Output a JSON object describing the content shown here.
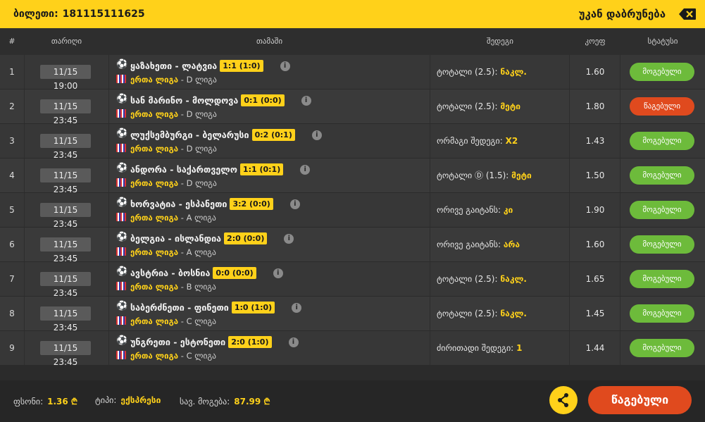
{
  "header": {
    "ticket_label": "ბილეთი:",
    "ticket_number": "181115111625",
    "back_label": "უკან დაბრუნება"
  },
  "columns": [
    "#",
    "თარიღი",
    "თამაში",
    "შედეგი",
    "კოეფ",
    "სტატუსი"
  ],
  "rows": [
    {
      "num": "1",
      "date": "11/15 19:00",
      "match": "ყაზახეთი - ლატვია",
      "score": "1:1 (1:0)",
      "league": "ერთა ლიგა",
      "league_suffix": "- D ლიგა",
      "event": "ტოტალი (2.5):",
      "pick": "ნაკლ.",
      "odds": "1.60",
      "status": "მოგებული",
      "status_type": "won"
    },
    {
      "num": "2",
      "date": "11/15 23:45",
      "match": "სან მარინო - მოლდოვა",
      "score": "0:1 (0:0)",
      "league": "ერთა ლიგა",
      "league_suffix": "- D ლიგა",
      "event": "ტოტალი (2.5):",
      "pick": "მეტი",
      "odds": "1.80",
      "status": "წაგებული",
      "status_type": "lost"
    },
    {
      "num": "3",
      "date": "11/15 23:45",
      "match": "ლუქსემბურგი - ბელარუსი",
      "score": "0:2 (0:1)",
      "league": "ერთა ლიგა",
      "league_suffix": "- D ლიგა",
      "event": "ორმაგი შედეგი:",
      "pick": "X2",
      "odds": "1.43",
      "status": "მოგებული",
      "status_type": "won"
    },
    {
      "num": "4",
      "date": "11/15 23:45",
      "match": "ანდორა - საქართველო",
      "score": "1:1 (0:1)",
      "league": "ერთა ლიგა",
      "league_suffix": "- D ლიგა",
      "event": "ტოტალი Ⓓ (1.5):",
      "pick": "მეტი",
      "odds": "1.50",
      "status": "მოგებული",
      "status_type": "won"
    },
    {
      "num": "5",
      "date": "11/15 23:45",
      "match": "ხორვატია - ესპანეთი",
      "score": "3:2 (0:0)",
      "league": "ერთა ლიგა",
      "league_suffix": "- A ლიგა",
      "event": "ორივე გაიტანს:",
      "pick": "კი",
      "odds": "1.90",
      "status": "მოგებული",
      "status_type": "won"
    },
    {
      "num": "6",
      "date": "11/15 23:45",
      "match": "ბელგია - ისლანდია",
      "score": "2:0 (0:0)",
      "league": "ერთა ლიგა",
      "league_suffix": "- A ლიგა",
      "event": "ორივე გაიტანს:",
      "pick": "არა",
      "odds": "1.60",
      "status": "მოგებული",
      "status_type": "won"
    },
    {
      "num": "7",
      "date": "11/15 23:45",
      "match": "ავსტრია - ბოსნია",
      "score": "0:0 (0:0)",
      "league": "ერთა ლიგა",
      "league_suffix": "- B ლიგა",
      "event": "ტოტალი (2.5):",
      "pick": "ნაკლ.",
      "odds": "1.65",
      "status": "მოგებული",
      "status_type": "won"
    },
    {
      "num": "8",
      "date": "11/15 23:45",
      "match": "საბერძნეთი - ფინეთი",
      "score": "1:0 (1:0)",
      "league": "ერთა ლიგა",
      "league_suffix": "- C ლიგა",
      "event": "ტოტალი (2.5):",
      "pick": "ნაკლ.",
      "odds": "1.45",
      "status": "მოგებული",
      "status_type": "won"
    },
    {
      "num": "9",
      "date": "11/15 23:45",
      "match": "უნგრეთი - ესტონეთი",
      "score": "2:0 (1:0)",
      "league": "ერთა ლიგა",
      "league_suffix": "- C ლიგა",
      "event": "ძირითადი შედეგი:",
      "pick": "1",
      "odds": "1.44",
      "status": "მოგებული",
      "status_type": "won"
    }
  ],
  "footer": {
    "stake_label": "ფსონი:",
    "stake_value": "1.36 ₾",
    "type_label": "ტიპი:",
    "type_value": "ექსპრესი",
    "win_label": "სავ. მოგება:",
    "win_value": "87.99 ₾",
    "status_button": "წაგებული"
  },
  "colors": {
    "accent": "#ffd11a",
    "won": "#6dbb3b",
    "lost": "#e04a1e"
  },
  "icons": [
    "backspace-icon",
    "soccer-ball-icon",
    "flag-icon",
    "info-icon",
    "share-icon"
  ]
}
